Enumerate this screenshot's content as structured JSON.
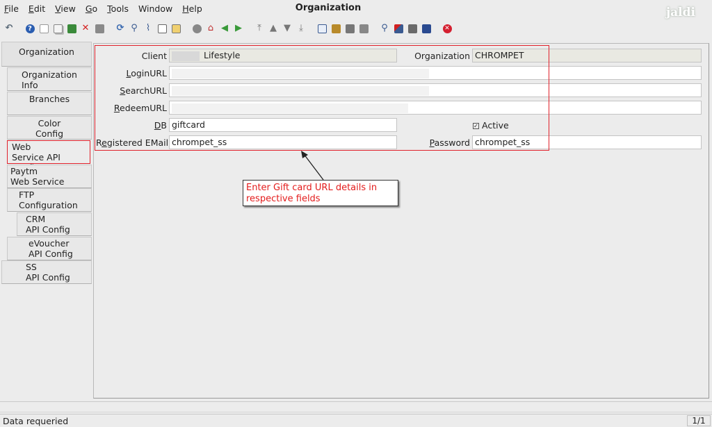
{
  "window": {
    "title": "Organization",
    "logo_text": "jaldi"
  },
  "menu": [
    {
      "u": "F",
      "rest": "ile"
    },
    {
      "u": "E",
      "rest": "dit"
    },
    {
      "u": "V",
      "rest": "iew"
    },
    {
      "u": "G",
      "rest": "o"
    },
    {
      "u": "T",
      "rest": "ools"
    },
    {
      "u": "",
      "rest": "Window"
    },
    {
      "u": "H",
      "rest": "elp"
    }
  ],
  "tabs": {
    "organization": "Organization",
    "org_info_1": "Organization",
    "org_info_2": "Info",
    "branches": "Branches",
    "color_1": "Color",
    "color_2": "Config",
    "web_1": "Web",
    "web_2": "Service API Config",
    "paytm_1": "Paytm",
    "paytm_2": "Web Service Config",
    "ftp_1": "FTP",
    "ftp_2": "Configuration",
    "crm_1": "CRM",
    "crm_2": "API Config",
    "evoucher_1": "eVoucher",
    "evoucher_2": "API Config",
    "ss_1": "SS",
    "ss_2": "API Config"
  },
  "form": {
    "client_label": "Client",
    "client_value": "Lifestyle",
    "organization_label": "Organization",
    "organization_value": "CHROMPET",
    "login_u": "L",
    "login_rest": "oginURL",
    "search_u": "S",
    "search_rest": "earchURL",
    "redeem_u": "R",
    "redeem_rest": "edeemURL",
    "db_u": "D",
    "db_rest": "B",
    "db_value": "giftcard",
    "active_label": "Active",
    "reg_u": "e",
    "reg_pre": "R",
    "reg_rest": "gistered EMail",
    "reg_value": "chrompet_ss",
    "password_u": "P",
    "password_rest": "assword",
    "password_value": "chrompet_ss"
  },
  "callout": {
    "text": "Enter Gift card URL details in respective fields"
  },
  "status": {
    "message": "Data requeried",
    "pager": "1/1"
  },
  "colors": {
    "annotation_red": "#e0202a",
    "callout_text": "#e31b1b"
  },
  "toolbar_icons": [
    "undo-icon",
    "help-icon",
    "new-icon",
    "copy-icon",
    "save-icon",
    "delete-icon",
    "print-preview-icon",
    "refresh-icon",
    "find-icon",
    "attachment-icon",
    "chat-icon",
    "calendar-icon",
    "history-icon",
    "home-icon",
    "back-icon",
    "forward-icon",
    "first-record-icon",
    "previous-record-icon",
    "next-record-icon",
    "last-record-icon",
    "report-icon",
    "archive-icon",
    "print-icon",
    "print-setup-icon",
    "zoom-icon",
    "workflow-icon",
    "product-icon",
    "request-icon",
    "exit-icon"
  ]
}
